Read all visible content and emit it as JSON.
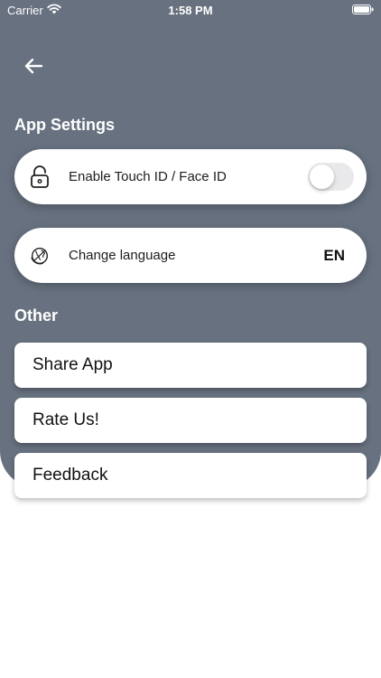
{
  "status_bar": {
    "carrier": "Carrier",
    "time": "1:58 PM"
  },
  "header": {
    "back_icon": "arrow-left-icon"
  },
  "sections": {
    "app_settings": {
      "title": "App Settings",
      "touch_id": {
        "label": "Enable Touch ID / Face ID",
        "icon": "lock-icon",
        "enabled": false
      },
      "language": {
        "label": "Change language",
        "icon": "globe-icon",
        "value": "EN"
      }
    },
    "other": {
      "title": "Other",
      "items": [
        {
          "label": "Share App"
        },
        {
          "label": "Rate Us!"
        },
        {
          "label": "Feedback"
        }
      ]
    }
  },
  "colors": {
    "panel": "#67717f",
    "card": "#ffffff",
    "toggle_off": "#e9e9eb"
  }
}
